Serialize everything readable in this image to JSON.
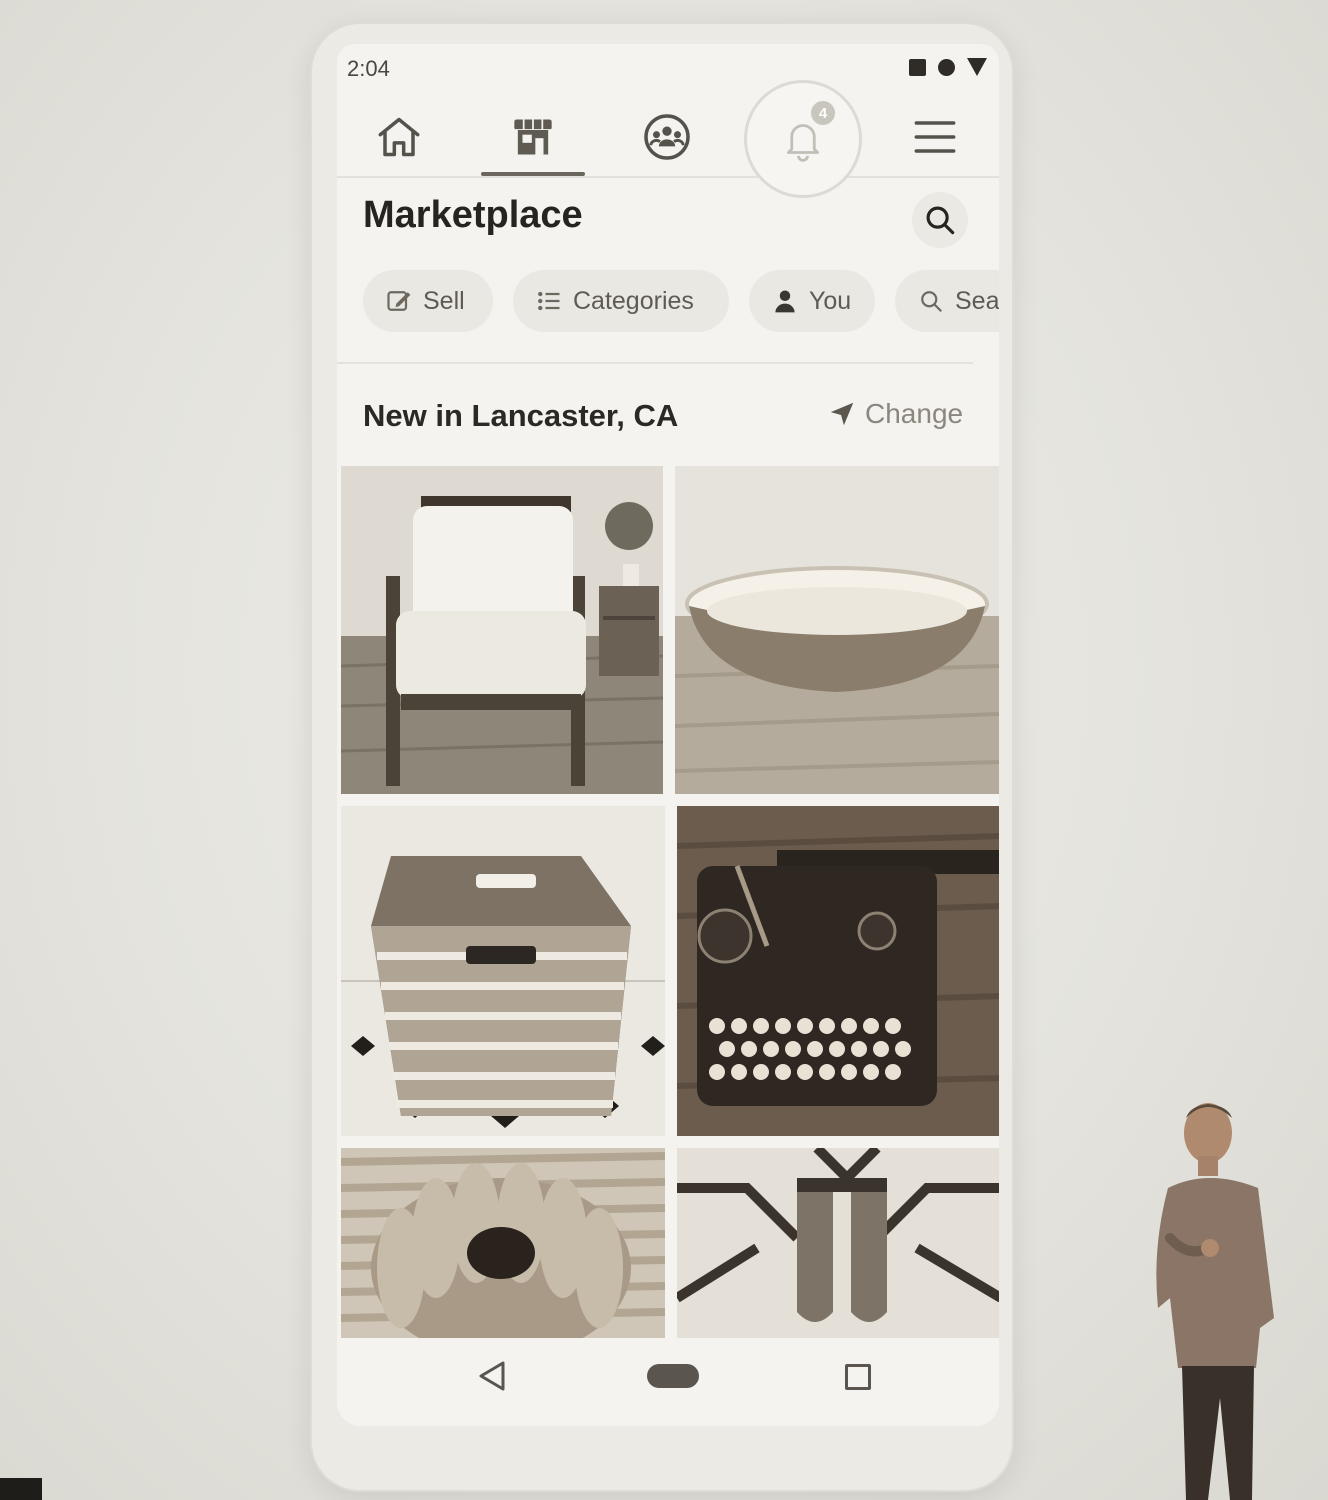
{
  "status_bar": {
    "time": "2:04"
  },
  "top_nav": {
    "tabs": [
      {
        "name": "home",
        "icon": "home-icon",
        "active": false
      },
      {
        "name": "marketplace",
        "icon": "storefront-icon",
        "active": true
      },
      {
        "name": "groups",
        "icon": "groups-icon",
        "active": false
      },
      {
        "name": "notifications",
        "icon": "bell-icon",
        "active": false,
        "badge": "4"
      },
      {
        "name": "menu",
        "icon": "hamburger-menu-icon",
        "active": false
      }
    ]
  },
  "header": {
    "title": "Marketplace",
    "search_icon": "search-icon"
  },
  "chips": [
    {
      "label": "Sell",
      "icon": "edit-icon"
    },
    {
      "label": "Categories",
      "icon": "list-icon"
    },
    {
      "label": "You",
      "icon": "person-icon"
    },
    {
      "label": "Sea",
      "icon": "search-icon"
    }
  ],
  "section": {
    "title": "New in Lancaster, CA",
    "change_label": "Change",
    "change_icon": "location-arrow-icon"
  },
  "listings": [
    {
      "depicts": "armchair"
    },
    {
      "depicts": "bowl"
    },
    {
      "depicts": "storage-bin"
    },
    {
      "depicts": "typewriter"
    },
    {
      "depicts": "bundt-pan"
    },
    {
      "depicts": "wall-hooks"
    }
  ],
  "colors": {
    "background": "#e3e2dc",
    "screen": "#f4f3ef",
    "text_dark": "#26241f",
    "text_muted": "#8b877e",
    "chip": "#e9e8e2"
  }
}
